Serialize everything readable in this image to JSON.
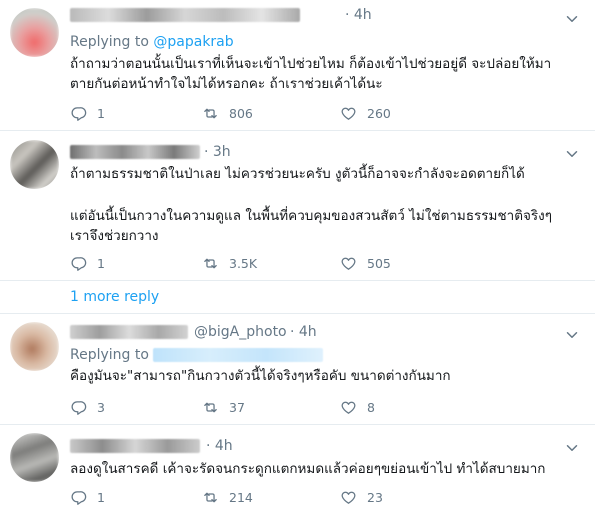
{
  "colors": {
    "text": "#14171a",
    "secondary": "#657786",
    "link": "#1da1f2",
    "divider": "#e6ecf0"
  },
  "icons": {
    "reply": "reply-icon",
    "retweet": "retweet-icon",
    "like": "heart-icon",
    "menu": "chevron-down-icon"
  },
  "tweets": [
    {
      "handle": "",
      "time": "· 4h",
      "replying_label": "Replying to",
      "replying_to": "@papakrab",
      "text": "ถ้าถามว่าตอนนั้นเป็นเราที่เห็นจะเข้าไปช่วยไหม ก็ต้องเข้าไปช่วยอยู่ดี จะปล่อยให้มาตายกันต่อหน้าทำใจไม่ได้หรอกคะ ถ้าเราช่วยเค้าได้นะ",
      "replies": "1",
      "retweets": "806",
      "likes": "260"
    },
    {
      "handle": "",
      "time": "· 3h",
      "text": "ถ้าตามธรรมชาติในป่าเลย ไม่ควรช่วยนะครับ งูตัวนี้ก็อาจจะกำลังจะอดตายก็ได้",
      "text2": "แต่อันนี้เป็นกวางในความดูแล ในพื้นที่ควบคุมของสวนสัตว์ ไม่ใช่ตามธรรมชาติจริงๆ เราจึงช่วยกวาง",
      "replies": "1",
      "retweets": "3.5K",
      "likes": "505"
    },
    {
      "more_replies": "1 more reply"
    },
    {
      "handle": "@bigA_photo",
      "time": "· 4h",
      "replying_label": "Replying to",
      "text": "คืองูมันจะ\"สามารถ\"กินกวางตัวนี้ได้จริงๆหรือคับ ขนาดต่างกันมาก",
      "replies": "3",
      "retweets": "37",
      "likes": "8"
    },
    {
      "handle": "",
      "time": "· 4h",
      "text": "ลองดูในสารคดี เค้าจะรัดจนกระดูกแตกหมดแล้วค่อยๆขย่อนเข้าไป ทำได้สบายมาก",
      "replies": "1",
      "retweets": "214",
      "likes": "23"
    }
  ]
}
